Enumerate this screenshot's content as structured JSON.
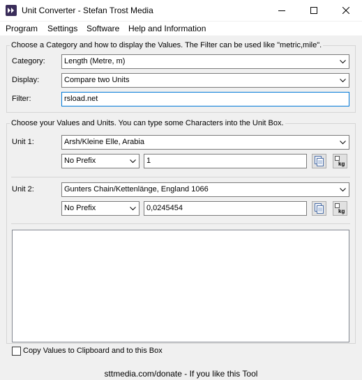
{
  "window": {
    "title": "Unit Converter - Stefan Trost Media",
    "icon": "app-double-arrow-icon",
    "controls": [
      "minimize-icon",
      "maximize-icon",
      "close-icon"
    ]
  },
  "menu": {
    "items": [
      "Program",
      "Settings",
      "Software",
      "Help and Information"
    ]
  },
  "category_group": {
    "caption": "Choose a Category and how to display the Values. The Filter can be used like \"metric,mile\".",
    "category_label": "Category:",
    "category_value": "Length (Metre, m)",
    "display_label": "Display:",
    "display_value": "Compare two Units",
    "filter_label": "Filter:",
    "filter_value": "rsload.net"
  },
  "values_group": {
    "caption": "Choose your Values and Units. You can type some Characters into the Unit Box.",
    "unit1": {
      "label": "Unit 1:",
      "unit_value": "Arsh/Kleine Elle, Arabia",
      "prefix": "No Prefix",
      "value": "1"
    },
    "unit2": {
      "label": "Unit 2:",
      "unit_value": "Gunters Chain/Kettenlänge, England 1066",
      "prefix": "No Prefix",
      "value": "0,0245454"
    },
    "copy_button_icon": "copy-icon",
    "kg_button_icon": "kg-unit-icon",
    "kg_icon_text": "kg"
  },
  "output": {
    "content": "",
    "copy_checkbox_label": "Copy Values to Clipboard and to this Box",
    "copy_checked": false
  },
  "status": {
    "text": "sttmedia.com/donate - If you like this Tool"
  },
  "colors": {
    "background": "#f0f0f0",
    "focus_border": "#0078d7",
    "app_icon": "#3a2d5a"
  }
}
